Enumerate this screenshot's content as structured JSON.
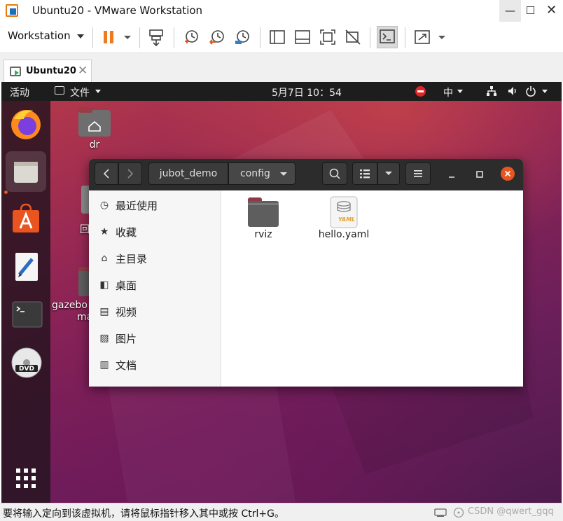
{
  "window": {
    "title": "Ubuntu20 - VMware Workstation",
    "controls": {
      "minimize": "—",
      "maximize": "☐",
      "close": "✕"
    }
  },
  "toolbar": {
    "workstation_menu": "Workstation",
    "icons": [
      "pause-icon",
      "dropdown-icon",
      "send-ctrl-alt-del-icon",
      "snapshot-take-icon",
      "snapshot-revert-icon",
      "snapshot-manager-icon",
      "sidebar-toggle-icon",
      "thumbnail-bar-icon",
      "fit-guest-icon",
      "unity-off-icon",
      "console-view-icon",
      "fullscreen-icon",
      "dropdown-icon"
    ]
  },
  "tabs": [
    {
      "label": "Ubuntu20",
      "close": "✕"
    }
  ],
  "guest": {
    "topbar": {
      "activities": "活动",
      "app_menu": "文件",
      "clock": "5月7日  10：54",
      "input_method": "中",
      "accent_color": "#e95420"
    },
    "dock": [
      "firefox-icon",
      "files-icon",
      "software-center-icon",
      "text-editor-icon",
      "terminal-icon",
      "dvd-icon",
      "show-apps-icon"
    ],
    "desktop_icons": [
      {
        "label": "dr"
      },
      {
        "label": "回"
      },
      {
        "label": "gazebo"
      },
      {
        "label": "ma"
      }
    ],
    "file_manager": {
      "path": [
        "jubot_demo",
        "config"
      ],
      "sidebar": [
        {
          "icon": "recent-icon",
          "label": "最近使用"
        },
        {
          "icon": "star-icon",
          "label": "收藏"
        },
        {
          "icon": "home-icon",
          "label": "主目录"
        },
        {
          "icon": "desktop-icon",
          "label": "桌面"
        },
        {
          "icon": "video-icon",
          "label": "视频"
        },
        {
          "icon": "picture-icon",
          "label": "图片"
        },
        {
          "icon": "document-icon",
          "label": "文档"
        }
      ],
      "files": [
        {
          "name": "rviz",
          "type": "folder"
        },
        {
          "name": "hello.yaml",
          "type": "yaml",
          "badge": "YAML"
        }
      ]
    }
  },
  "statusbar": {
    "message": "要将输入定向到该虚拟机，请将鼠标指针移入其中或按 Ctrl+G。",
    "watermark": "CSDN @qwert_gqq"
  }
}
